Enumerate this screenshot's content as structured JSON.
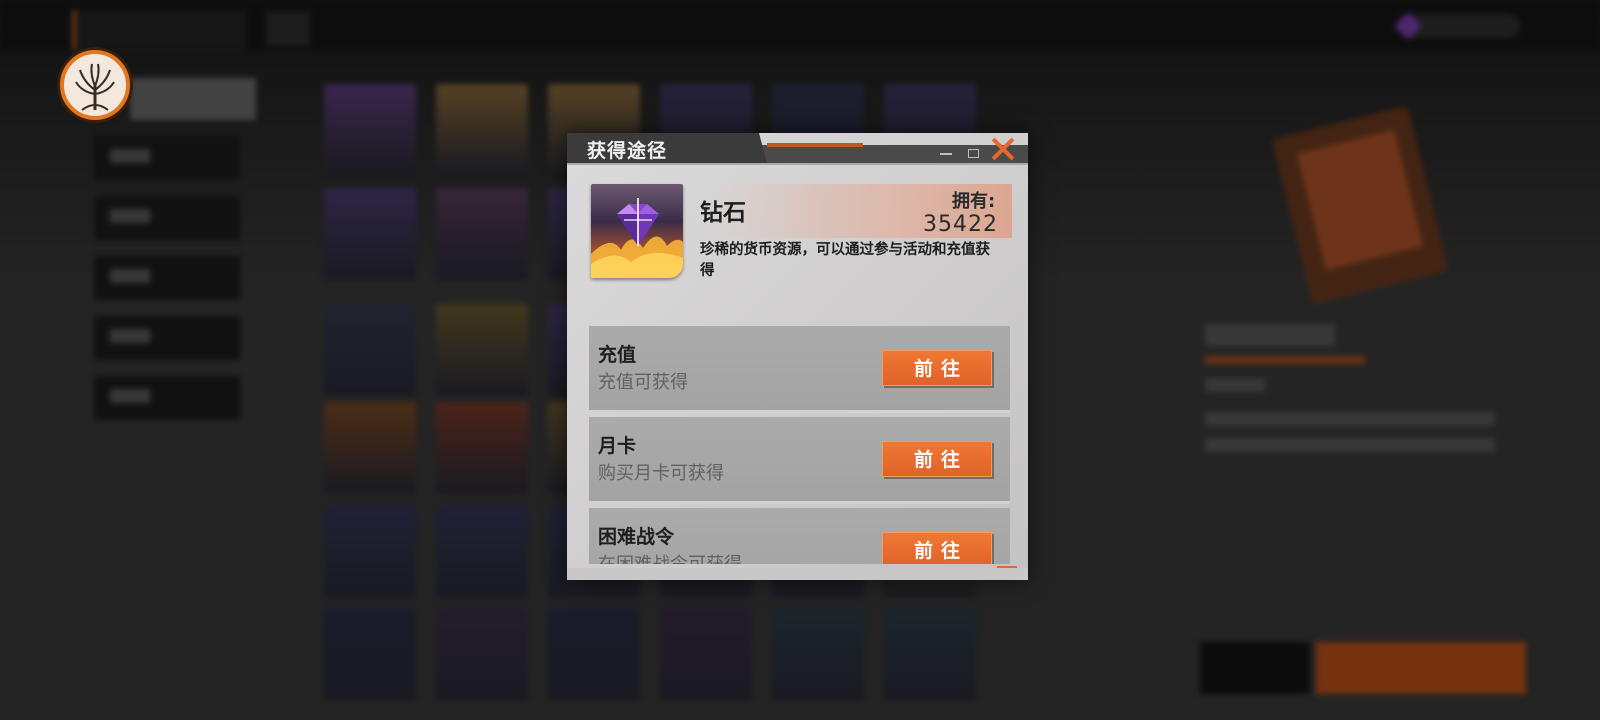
{
  "modal": {
    "title": "获得途径",
    "item": {
      "name": "钻石",
      "owned_label": "拥有:",
      "owned_value": "35422",
      "description": "珍稀的货币资源，可以通过参与活动和充值获得"
    },
    "paths": [
      {
        "name": "充值",
        "subtitle": "充值可获得",
        "button": "前往"
      },
      {
        "name": "月卡",
        "subtitle": "购买月卡可获得",
        "button": "前往"
      },
      {
        "name": "困难战令",
        "subtitle": "在困难战令可获得",
        "button": "前往"
      }
    ]
  },
  "icons": {
    "avatar": "tree-emblem-icon",
    "close": "close-icon",
    "item": "diamond-icon"
  },
  "colors": {
    "accent": "#e8682a",
    "button": "#e0622a",
    "avatar_ring": "#e1781f"
  }
}
